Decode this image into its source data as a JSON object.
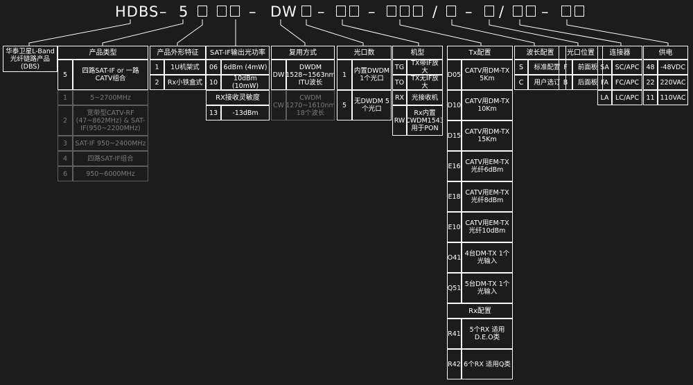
{
  "code": {
    "prefix": "HDBS",
    "d1": "–",
    "five": "5",
    "d2": "–",
    "dw": "DW",
    "d3": "–",
    "d4": "–",
    "s1": "/",
    "d5": "–",
    "s2": "/",
    "d6": "–"
  },
  "brand": {
    "label": "华泰卫星L-Band 光纤链路产品 (DBS)"
  },
  "product_type": {
    "header": "产品类型",
    "rows": [
      {
        "code": "5",
        "text": "四路SAT-IF or 一路CATV组合"
      }
    ],
    "dim_rows": [
      {
        "code": "1",
        "text": "5~2700MHz"
      },
      {
        "code": "2",
        "text": "宽带型CATV-RF (47~862MHz) & SAT-IF(950~2200MHz)"
      },
      {
        "code": "3",
        "text": "SAT-IF 950~2400MHz"
      },
      {
        "code": "4",
        "text": "四路SAT-IF组合"
      },
      {
        "code": "6",
        "text": "950~6000MHz"
      }
    ]
  },
  "form_factor": {
    "header": "产品外形特征",
    "rows": [
      {
        "code": "1",
        "text": "1U机架式"
      },
      {
        "code": "2",
        "text": "Rx小铁盒式"
      }
    ]
  },
  "sat_power": {
    "header": "SAT-IF输出光功率",
    "rows": [
      {
        "code": "06",
        "text": "6dBm (4mW)"
      },
      {
        "code": "10",
        "text": "10dBm (10mW)"
      }
    ]
  },
  "rx_sens": {
    "header": "RX接收灵敏度",
    "rows": [
      {
        "code": "13",
        "text": "-13dBm"
      }
    ]
  },
  "mux": {
    "header": "复用方式",
    "rows": [
      {
        "code": "DW",
        "text": "DWDM 1528~1563nm ITU波长"
      }
    ],
    "dim_rows": [
      {
        "code": "CW",
        "text": "CWDM 1270~1610nm 18个波长"
      }
    ]
  },
  "ports": {
    "header": "光口数",
    "rows": [
      {
        "code": "1",
        "text": "内置DWDM 1个光口"
      },
      {
        "code": "5",
        "text": "无DWDM 5个光口"
      }
    ]
  },
  "model": {
    "header": "机型",
    "rows": [
      {
        "code": "TG",
        "text": "TX带IF放大"
      },
      {
        "code": "TO",
        "text": "TX无IF放大"
      },
      {
        "code": "RX",
        "text": "光接收机"
      },
      {
        "code": "RW",
        "text": "Rx内置 CWDM1543 用于PON"
      }
    ]
  },
  "tx_cfg": {
    "header": "Tx配置",
    "rows": [
      {
        "code": "D05",
        "text": "CATV用DM-TX 5Km"
      },
      {
        "code": "D10",
        "text": "CATV用DM-TX 10Km"
      },
      {
        "code": "D15",
        "text": "CATV用DM-TX 15Km"
      },
      {
        "code": "E16",
        "text": "CATV用EM-TX 光纤6dBm"
      },
      {
        "code": "E18",
        "text": "CATV用EM-TX 光纤8dBm"
      },
      {
        "code": "E10",
        "text": "CATV用EM-TX 光纤10dBm"
      },
      {
        "code": "O41",
        "text": "4台DM-TX 1个光输入"
      },
      {
        "code": "Q51",
        "text": "5台DM-TX 1个光输入"
      }
    ]
  },
  "rx_cfg": {
    "header": "Rx配置",
    "rows": [
      {
        "code": "R41",
        "text": "5个RX 适用D.E.O类"
      },
      {
        "code": "R42",
        "text": "6个RX 适用Q类"
      }
    ]
  },
  "wavelength": {
    "header": "波长配置",
    "rows": [
      {
        "code": "S",
        "text": "标准配置"
      },
      {
        "code": "C",
        "text": "用户选订"
      }
    ]
  },
  "port_pos": {
    "header": "光口位置",
    "rows": [
      {
        "code": "F",
        "text": "前面板"
      },
      {
        "code": "B",
        "text": "后面板"
      }
    ]
  },
  "connector": {
    "header": "连接器",
    "rows": [
      {
        "code": "SA",
        "text": "SC/APC"
      },
      {
        "code": "FA",
        "text": "FC/APC"
      },
      {
        "code": "LA",
        "text": "LC/APC"
      }
    ]
  },
  "power": {
    "header": "供电",
    "rows": [
      {
        "code": "48",
        "text": "-48VDC"
      },
      {
        "code": "22",
        "text": "220VAC"
      },
      {
        "code": "11",
        "text": "110VAC"
      }
    ]
  }
}
